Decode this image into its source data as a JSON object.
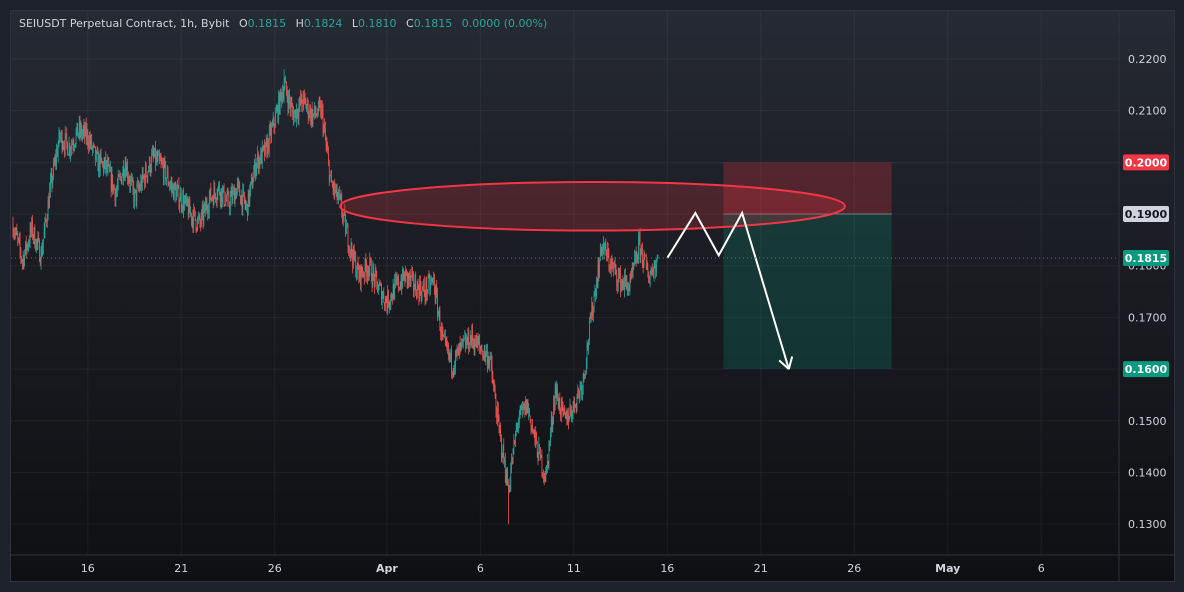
{
  "header": {
    "title": "SEIUSDT Perpetual Contract, 1h, Bybit",
    "open_label": "O",
    "open": "0.1815",
    "high_label": "H",
    "high": "0.1824",
    "low_label": "L",
    "low": "0.1810",
    "close_label": "C",
    "close": "0.1815",
    "change": "0.0000 (0.00%)"
  },
  "colors": {
    "up": "#26a69a",
    "down": "#ef5350",
    "stop": "#f23645",
    "target": "#089981",
    "entry": "#787b86",
    "drawing": "#ffffff",
    "ellipse": "#f23645"
  },
  "chart_data": {
    "type": "candlestick",
    "symbol": "SEIUSDT",
    "interval": "1h",
    "exchange": "Bybit",
    "ylim": [
      0.125,
      0.2285
    ],
    "y_ticks": [
      "0.1300",
      "0.1400",
      "0.1500",
      "0.1600",
      "0.1700",
      "0.1800",
      "0.1900",
      "0.2000",
      "0.2100",
      "0.2200"
    ],
    "x_range": [
      "2024-03-12T00:00",
      "2024-05-10T00:00"
    ],
    "x_ticks": [
      {
        "label": "16",
        "date": "2024-03-16"
      },
      {
        "label": "21",
        "date": "2024-03-21"
      },
      {
        "label": "26",
        "date": "2024-03-26"
      },
      {
        "label": "Apr",
        "date": "2024-04-01",
        "bold": true
      },
      {
        "label": "6",
        "date": "2024-04-06"
      },
      {
        "label": "11",
        "date": "2024-04-11"
      },
      {
        "label": "16",
        "date": "2024-04-16"
      },
      {
        "label": "21",
        "date": "2024-04-21"
      },
      {
        "label": "26",
        "date": "2024-04-26"
      },
      {
        "label": "May",
        "date": "2024-05-01",
        "bold": true
      },
      {
        "label": "6",
        "date": "2024-05-06"
      }
    ],
    "price_path": [
      [
        "2024-03-12T00:00",
        0.188
      ],
      [
        "2024-03-12T12:00",
        0.181
      ],
      [
        "2024-03-13T00:00",
        0.187
      ],
      [
        "2024-03-13T12:00",
        0.182
      ],
      [
        "2024-03-14T00:00",
        0.195
      ],
      [
        "2024-03-14T12:00",
        0.205
      ],
      [
        "2024-03-15T00:00",
        0.203
      ],
      [
        "2024-03-15T12:00",
        0.206
      ],
      [
        "2024-03-16T00:00",
        0.205
      ],
      [
        "2024-03-16T12:00",
        0.2
      ],
      [
        "2024-03-17T00:00",
        0.199
      ],
      [
        "2024-03-17T12:00",
        0.194
      ],
      [
        "2024-03-18T00:00",
        0.2
      ],
      [
        "2024-03-18T12:00",
        0.193
      ],
      [
        "2024-03-19T00:00",
        0.197
      ],
      [
        "2024-03-19T12:00",
        0.201
      ],
      [
        "2024-03-20T00:00",
        0.199
      ],
      [
        "2024-03-20T12:00",
        0.195
      ],
      [
        "2024-03-21T00:00",
        0.193
      ],
      [
        "2024-03-21T12:00",
        0.19
      ],
      [
        "2024-03-22T00:00",
        0.188
      ],
      [
        "2024-03-22T12:00",
        0.193
      ],
      [
        "2024-03-23T00:00",
        0.195
      ],
      [
        "2024-03-23T12:00",
        0.192
      ],
      [
        "2024-03-24T00:00",
        0.195
      ],
      [
        "2024-03-24T12:00",
        0.191
      ],
      [
        "2024-03-25T00:00",
        0.2
      ],
      [
        "2024-03-25T12:00",
        0.202
      ],
      [
        "2024-03-26T00:00",
        0.208
      ],
      [
        "2024-03-26T12:00",
        0.215
      ],
      [
        "2024-03-27T00:00",
        0.209
      ],
      [
        "2024-03-27T12:00",
        0.212
      ],
      [
        "2024-03-28T00:00",
        0.209
      ],
      [
        "2024-03-28T12:00",
        0.21
      ],
      [
        "2024-03-29T00:00",
        0.196
      ],
      [
        "2024-03-29T12:00",
        0.192
      ],
      [
        "2024-03-30T00:00",
        0.184
      ],
      [
        "2024-03-30T12:00",
        0.178
      ],
      [
        "2024-03-31T00:00",
        0.18
      ],
      [
        "2024-03-31T12:00",
        0.176
      ],
      [
        "2024-04-01T00:00",
        0.173
      ],
      [
        "2024-04-01T12:00",
        0.176
      ],
      [
        "2024-04-02T00:00",
        0.178
      ],
      [
        "2024-04-02T12:00",
        0.176
      ],
      [
        "2024-04-03T00:00",
        0.175
      ],
      [
        "2024-04-03T12:00",
        0.177
      ],
      [
        "2024-04-04T00:00",
        0.165
      ],
      [
        "2024-04-04T12:00",
        0.161
      ],
      [
        "2024-04-05T00:00",
        0.164
      ],
      [
        "2024-04-05T12:00",
        0.166
      ],
      [
        "2024-04-06T00:00",
        0.164
      ],
      [
        "2024-04-06T12:00",
        0.162
      ],
      [
        "2024-04-07T00:00",
        0.148
      ],
      [
        "2024-04-07T12:00",
        0.137
      ],
      [
        "2024-04-08T00:00",
        0.15
      ],
      [
        "2024-04-08T12:00",
        0.153
      ],
      [
        "2024-04-09T00:00",
        0.145
      ],
      [
        "2024-04-09T12:00",
        0.139
      ],
      [
        "2024-04-10T00:00",
        0.156
      ],
      [
        "2024-04-10T12:00",
        0.15
      ],
      [
        "2024-04-11T00:00",
        0.153
      ],
      [
        "2024-04-11T12:00",
        0.158
      ],
      [
        "2024-04-12T00:00",
        0.172
      ],
      [
        "2024-04-12T12:00",
        0.184
      ],
      [
        "2024-04-13T00:00",
        0.18
      ],
      [
        "2024-04-13T12:00",
        0.177
      ],
      [
        "2024-04-14T00:00",
        0.176
      ],
      [
        "2024-04-14T12:00",
        0.184
      ],
      [
        "2024-04-15T00:00",
        0.178
      ],
      [
        "2024-04-15T12:00",
        0.1815
      ]
    ],
    "extremes": {
      "high": {
        "date": "2024-03-26T12:00",
        "price": 0.218
      },
      "low": {
        "date": "2024-04-07T12:00",
        "price": 0.13
      }
    },
    "last_price": 0.1815,
    "position": {
      "type": "short",
      "entry": 0.19,
      "stop": 0.2,
      "target": 0.16,
      "start": "2024-04-19T00:00",
      "end": "2024-04-28T00:00"
    },
    "resistance_zone": {
      "start": "2024-03-29T12:00",
      "end": "2024-04-25T12:00",
      "center": 0.1915,
      "half_height": 0.0047
    },
    "projection_path": [
      [
        "2024-04-16T00:00",
        0.1815
      ],
      [
        "2024-04-17T12:00",
        0.1902
      ],
      [
        "2024-04-18T18:00",
        0.182
      ],
      [
        "2024-04-20T00:00",
        0.1902
      ],
      [
        "2024-04-22T12:00",
        0.16
      ]
    ],
    "badges": [
      {
        "text": "0.2000",
        "price": 0.2,
        "color": "#f23645"
      },
      {
        "text": "0.1900",
        "price": 0.19,
        "color": "#d1d4dc"
      },
      {
        "text": "0.1815",
        "price": 0.1815,
        "color": "#089981"
      },
      {
        "text": "0.1600",
        "price": 0.16,
        "color": "#089981"
      }
    ]
  }
}
